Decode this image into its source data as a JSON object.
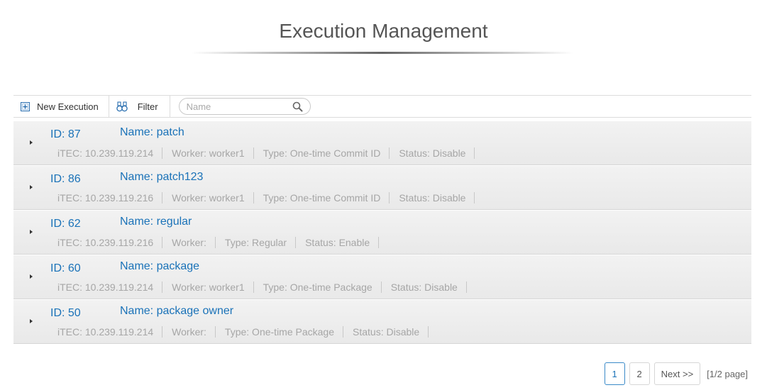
{
  "header": {
    "title": "Execution Management"
  },
  "toolbar": {
    "new_execution_label": "New Execution",
    "filter_label": "Filter",
    "search_placeholder": "Name",
    "search_value": ""
  },
  "executions": [
    {
      "id": "ID: 87",
      "name": "Name: patch",
      "itec": "iTEC: 10.239.119.214",
      "worker": "Worker: worker1",
      "type": "Type: One-time Commit ID",
      "status": "Status: Disable"
    },
    {
      "id": "ID: 86",
      "name": "Name: patch123",
      "itec": "iTEC: 10.239.119.216",
      "worker": "Worker: worker1",
      "type": "Type: One-time Commit ID",
      "status": "Status: Disable"
    },
    {
      "id": "ID: 62",
      "name": "Name: regular",
      "itec": "iTEC: 10.239.119.216",
      "worker": "Worker:",
      "type": "Type: Regular",
      "status": "Status: Enable"
    },
    {
      "id": "ID: 60",
      "name": "Name: package",
      "itec": "iTEC: 10.239.119.214",
      "worker": "Worker: worker1",
      "type": "Type: One-time Package",
      "status": "Status: Disable"
    },
    {
      "id": "ID: 50",
      "name": "Name: package owner",
      "itec": "iTEC: 10.239.119.214",
      "worker": "Worker:",
      "type": "Type: One-time Package",
      "status": "Status: Disable"
    }
  ],
  "pagination": {
    "pages": [
      "1",
      "2"
    ],
    "current": "1",
    "next_label": "Next >>",
    "info": "[1/2 page]"
  },
  "colors": {
    "link": "#1a72b8",
    "meta": "#a6a6a6",
    "title": "#555555"
  }
}
